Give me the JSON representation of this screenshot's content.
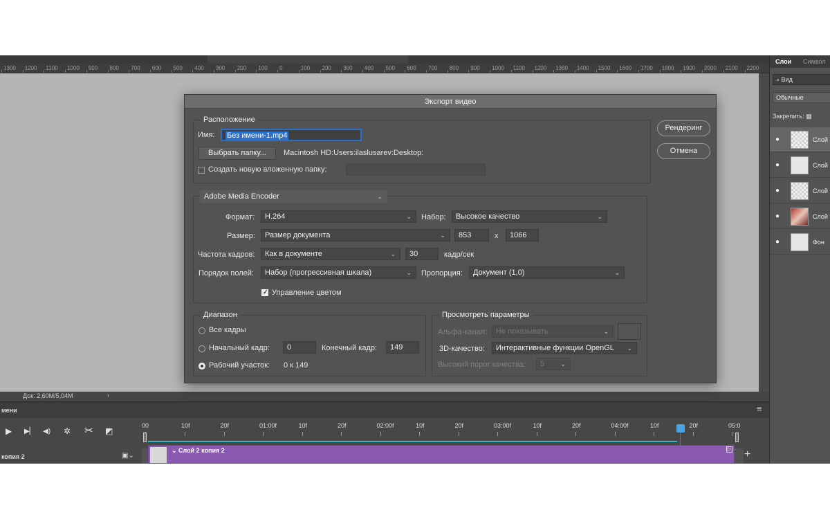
{
  "ruler": {
    "ticks": [
      "1300",
      "1200",
      "1100",
      "1000",
      "900",
      "800",
      "700",
      "600",
      "500",
      "400",
      "300",
      "200",
      "100",
      "0",
      "100",
      "200",
      "300",
      "400",
      "500",
      "600",
      "700",
      "800",
      "900",
      "1000",
      "1100",
      "1200",
      "1300",
      "1400",
      "1500",
      "1600",
      "1700",
      "1800",
      "1900",
      "2000",
      "2100",
      "2200"
    ]
  },
  "status": {
    "doc": "Док: 2,60M/5,04M",
    "arrow": "›"
  },
  "timeline": {
    "panel_name": "мени",
    "frames": [
      "00",
      "10f",
      "20f",
      "01:00f",
      "10f",
      "20f",
      "02:00f",
      "10f",
      "20f",
      "03:00f",
      "10f",
      "20f",
      "04:00f",
      "10f",
      "20f",
      "05:0"
    ],
    "layer_label": "копия 2",
    "clip_label": "Слой 2 копия 2"
  },
  "panel": {
    "tabs": [
      "Слои",
      "Символ"
    ],
    "search": "Вид",
    "blend": "Обычные",
    "lock": "Закрепить:",
    "layers": [
      {
        "name": "Слой",
        "thumb": "checker",
        "selected": true
      },
      {
        "name": "Слой",
        "thumb": "white",
        "selected": false
      },
      {
        "name": "Слой",
        "thumb": "checker",
        "selected": false
      },
      {
        "name": "Слой",
        "thumb": "photo",
        "selected": false
      },
      {
        "name": "Фон",
        "thumb": "white",
        "selected": false
      }
    ]
  },
  "dialog": {
    "title": "Экспорт видео",
    "location": {
      "group": "Расположение",
      "name_label": "Имя:",
      "name_value": "Без имени-1.mp4",
      "choose_folder": "Выбрать папку...",
      "path": "Macintosh HD:Users:ilaslusarev:Desktop:",
      "subfolder_label": "Создать новую вложенную папку:",
      "subfolder_checked": false
    },
    "buttons": {
      "render": "Рендеринг",
      "cancel": "Отмена"
    },
    "encoder": "Adobe Media Encoder",
    "format_label": "Формат:",
    "format": "H.264",
    "preset_label": "Набор:",
    "preset": "Высокое качество",
    "size_label": "Размер:",
    "size": "Размер документа",
    "width": "853",
    "x": "x",
    "height": "1066",
    "fps_label": "Частота кадров:",
    "fps_mode": "Как в документе",
    "fps": "30",
    "fps_unit": "кадр/сек",
    "field_order_label": "Порядок полей:",
    "field_order": "Набор (прогрессивная шкала)",
    "aspect_label": "Пропорция:",
    "aspect": "Документ (1,0)",
    "color_mgmt": "Управление цветом",
    "color_mgmt_checked": true,
    "range": {
      "group": "Диапазон",
      "all_frames": "Все кадры",
      "start_label": "Начальный кадр:",
      "start": "0",
      "end_label": "Конечный кадр:",
      "end": "149",
      "work_area": "Рабочий участок:",
      "work_value": "0 к 149",
      "selected": "work_area"
    },
    "preview": {
      "group": "Просмотреть параметры",
      "alpha_label": "Альфа-канал:",
      "alpha": "Не показывать",
      "quality3d_label": "3D-качество:",
      "quality3d": "Интерактивные функции OpenGL",
      "hq_label": "Высокий порог качества:",
      "hq": "5"
    }
  },
  "colors": {
    "accent": "#2d6ec6",
    "clip": "#8a5ab0",
    "teal": "#39b7bf",
    "playhead": "#e0403f"
  }
}
